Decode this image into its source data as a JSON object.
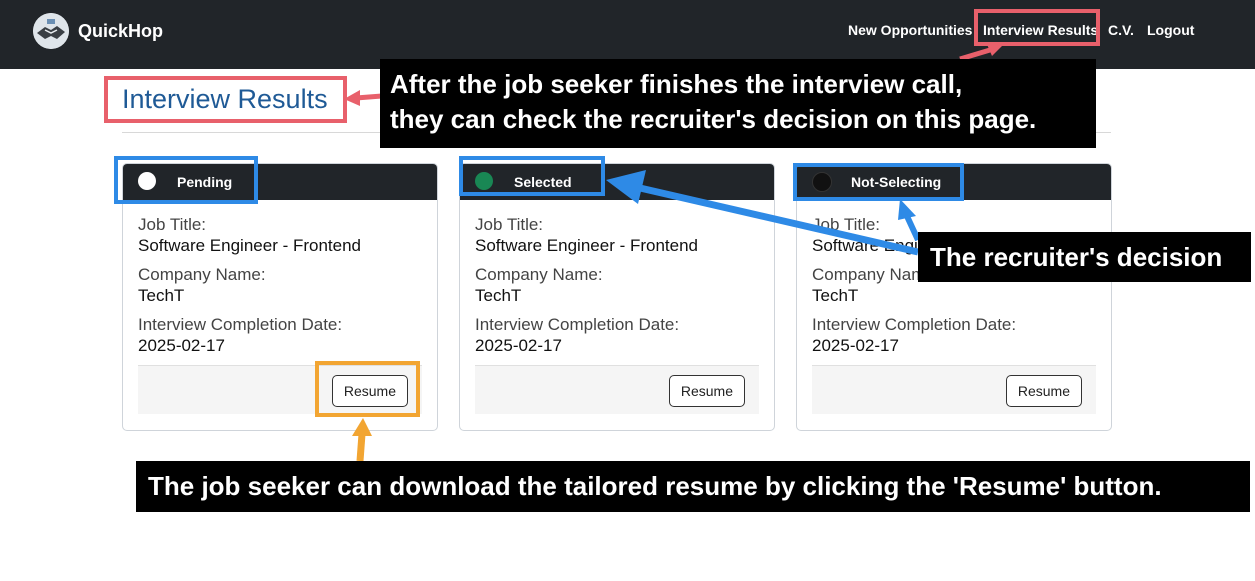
{
  "brand": {
    "name": "QuickHop"
  },
  "nav": {
    "items": [
      {
        "label": "New Opportunities"
      },
      {
        "label": "Interview Results"
      },
      {
        "label": "C.V."
      },
      {
        "label": "Logout"
      }
    ]
  },
  "page": {
    "title": "Interview Results"
  },
  "labels": {
    "job_title": "Job Title:",
    "company_name": "Company Name:",
    "completion_date": "Interview Completion Date:",
    "resume_button": "Resume"
  },
  "cards": [
    {
      "status": "Pending",
      "status_color": "#ffffff",
      "job_title": "Software Engineer - Frontend",
      "company": "TechT",
      "date": "2025-02-17"
    },
    {
      "status": "Selected",
      "status_color": "#198754",
      "job_title": "Software Engineer - Frontend",
      "company": "TechT",
      "date": "2025-02-17"
    },
    {
      "status": "Not-Selecting",
      "status_color": "#111111",
      "job_title": "Software Engineer - Frontend",
      "company": "TechT",
      "date": "2025-02-17"
    }
  ],
  "annotations": {
    "top": {
      "line1": "After the job seeker finishes the interview call,",
      "line2": "they can check the recruiter's decision on this page."
    },
    "decision": "The recruiter's decision",
    "bottom": "The job seeker can download the tailored resume by clicking the 'Resume' button."
  },
  "colors": {
    "navbar": "#212529",
    "title": "#1f5a96",
    "highlight_red": "#e8606b",
    "highlight_blue": "#2e8ae6",
    "highlight_orange": "#f2a532"
  }
}
